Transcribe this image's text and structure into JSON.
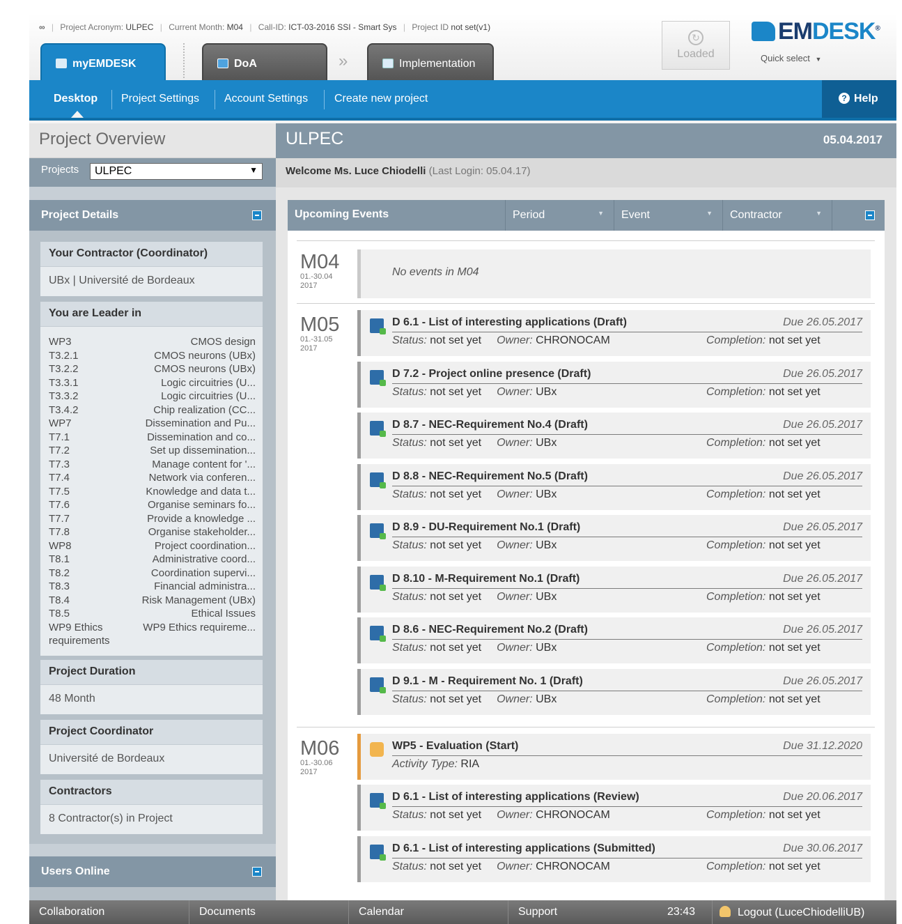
{
  "header": {
    "info": {
      "acronym_label": "Project Acronym:",
      "acronym": "ULPEC",
      "month_label": "Current Month:",
      "month": "M04",
      "call_label": "Call-ID:",
      "call": "ICT-03-2016 SSI - Smart Sys",
      "project_id_label": "Project ID",
      "project_id": "not set(v1)"
    },
    "tabs": [
      {
        "label": "myEMDESK"
      },
      {
        "label": "DoA"
      },
      {
        "label": "Implementation"
      }
    ],
    "loaded_label": "Loaded",
    "logo": {
      "prefix": "EM",
      "suffix": "DESK",
      "reg": "®"
    },
    "quick_select": "Quick select"
  },
  "nav": {
    "items": [
      "Desktop",
      "Project Settings",
      "Account Settings",
      "Create new project"
    ],
    "help": "Help"
  },
  "left": {
    "title": "Project Overview",
    "projects_label": "Projects",
    "project_selected": "ULPEC",
    "details_title": "Project Details",
    "contractor": {
      "title": "Your Contractor (Coordinator)",
      "value": "UBx | Université de Bordeaux"
    },
    "leader": {
      "title": "You are Leader in",
      "items": [
        {
          "k": "WP3",
          "v": "CMOS design"
        },
        {
          "k": "T3.2.1",
          "v": "CMOS neurons (UBx)"
        },
        {
          "k": "T3.2.2",
          "v": "CMOS neurons (UBx)"
        },
        {
          "k": "T3.3.1",
          "v": "Logic circuitries (U..."
        },
        {
          "k": "T3.3.2",
          "v": "Logic circuitries (U..."
        },
        {
          "k": "T3.4.2",
          "v": "Chip realization (CC..."
        },
        {
          "k": "WP7",
          "v": "Dissemination and Pu..."
        },
        {
          "k": "T7.1",
          "v": "Dissemination and co..."
        },
        {
          "k": "T7.2",
          "v": "Set up dissemination..."
        },
        {
          "k": "T7.3",
          "v": "Manage content for '..."
        },
        {
          "k": "T7.4",
          "v": "Network via conferen..."
        },
        {
          "k": "T7.5",
          "v": "Knowledge and data t..."
        },
        {
          "k": "T7.6",
          "v": "Organise seminars fo..."
        },
        {
          "k": "T7.7",
          "v": "Provide a knowledge ..."
        },
        {
          "k": "T7.8",
          "v": "Organise stakeholder..."
        },
        {
          "k": "WP8",
          "v": "Project coordination..."
        },
        {
          "k": "T8.1",
          "v": "Administrative coord..."
        },
        {
          "k": "T8.2",
          "v": "Coordination supervi..."
        },
        {
          "k": "T8.3",
          "v": "Financial administra..."
        },
        {
          "k": "T8.4",
          "v": "Risk Management (UBx)"
        },
        {
          "k": "T8.5",
          "v": "Ethical Issues"
        },
        {
          "k": "WP9 Ethics requirements",
          "v": "WP9 Ethics requireme..."
        }
      ]
    },
    "duration": {
      "title": "Project Duration",
      "value": "48 Month"
    },
    "coordinator": {
      "title": "Project Coordinator",
      "value": "Université de Bordeaux"
    },
    "contractors": {
      "title": "Contractors",
      "value": "8 Contractor(s) in Project"
    },
    "users_online": "Users Online"
  },
  "right": {
    "title": "ULPEC",
    "date": "05.04.2017",
    "welcome": "Welcome Ms. Luce Chiodelli",
    "last_login": "(Last Login: 05.04.17)",
    "events_title": "Upcoming Events",
    "columns": [
      "Period",
      "Event",
      "Contractor"
    ],
    "labels": {
      "status": "Status:",
      "owner": "Owner:",
      "completion": "Completion:",
      "activity_type": "Activity Type:"
    },
    "months": [
      {
        "name": "M04",
        "range": "01.-30.04",
        "year": "2017",
        "empty_text": "No events in M04"
      },
      {
        "name": "M05",
        "range": "01.-31.05",
        "year": "2017"
      },
      {
        "name": "M06",
        "range": "01.-30.06",
        "year": "2017"
      }
    ],
    "events": [
      {
        "title": "D 6.1 - List of interesting applications (Draft)",
        "due": "Due 26.05.2017",
        "status": "not set yet",
        "owner": "CHRONOCAM",
        "completion": "not set yet"
      },
      {
        "title": "D 7.2 - Project online presence (Draft)",
        "due": "Due 26.05.2017",
        "status": "not set yet",
        "owner": "UBx",
        "completion": "not set yet"
      },
      {
        "title": "D 8.7 - NEC-Requirement No.4 (Draft)",
        "due": "Due 26.05.2017",
        "status": "not set yet",
        "owner": "UBx",
        "completion": "not set yet"
      },
      {
        "title": "D 8.8 - NEC-Requirement No.5 (Draft)",
        "due": "Due 26.05.2017",
        "status": "not set yet",
        "owner": "UBx",
        "completion": "not set yet"
      },
      {
        "title": "D 8.9 - DU-Requirement No.1 (Draft)",
        "due": "Due 26.05.2017",
        "status": "not set yet",
        "owner": "UBx",
        "completion": "not set yet"
      },
      {
        "title": "D 8.10 - M-Requirement No.1 (Draft)",
        "due": "Due 26.05.2017",
        "status": "not set yet",
        "owner": "UBx",
        "completion": "not set yet"
      },
      {
        "title": "D 8.6 - NEC-Requirement No.2 (Draft)",
        "due": "Due 26.05.2017",
        "status": "not set yet",
        "owner": "UBx",
        "completion": "not set yet"
      },
      {
        "title": "D 9.1 - M - Requirement No. 1 (Draft)",
        "due": "Due 26.05.2017",
        "status": "not set yet",
        "owner": "UBx",
        "completion": "not set yet"
      },
      {
        "title": "WP5 - Evaluation (Start)",
        "due": "Due 31.12.2020",
        "activity_type": "RIA"
      },
      {
        "title": "D 6.1 - List of interesting applications (Review)",
        "due": "Due 20.06.2017",
        "status": "not set yet",
        "owner": "CHRONOCAM",
        "completion": "not set yet"
      },
      {
        "title": "D 6.1 - List of interesting applications (Submitted)",
        "due": "Due 30.06.2017",
        "status": "not set yet",
        "owner": "CHRONOCAM",
        "completion": "not set yet"
      }
    ]
  },
  "footer": {
    "items": [
      "Collaboration",
      "Documents",
      "Calendar",
      "Support"
    ],
    "time": "23:43",
    "logout": "Logout (LuceChiodelliUB)"
  },
  "colors": {
    "accent": "#1b86c8",
    "panel": "#8396a5",
    "activity": "#e59a3e"
  },
  "icons": [
    "link-icon",
    "list-icon",
    "edit-icon",
    "document-icon",
    "reload-icon",
    "help-icon",
    "minus-icon",
    "deliverable-icon",
    "activity-box-icon",
    "user-icon",
    "dropdown-arrow-icon"
  ]
}
